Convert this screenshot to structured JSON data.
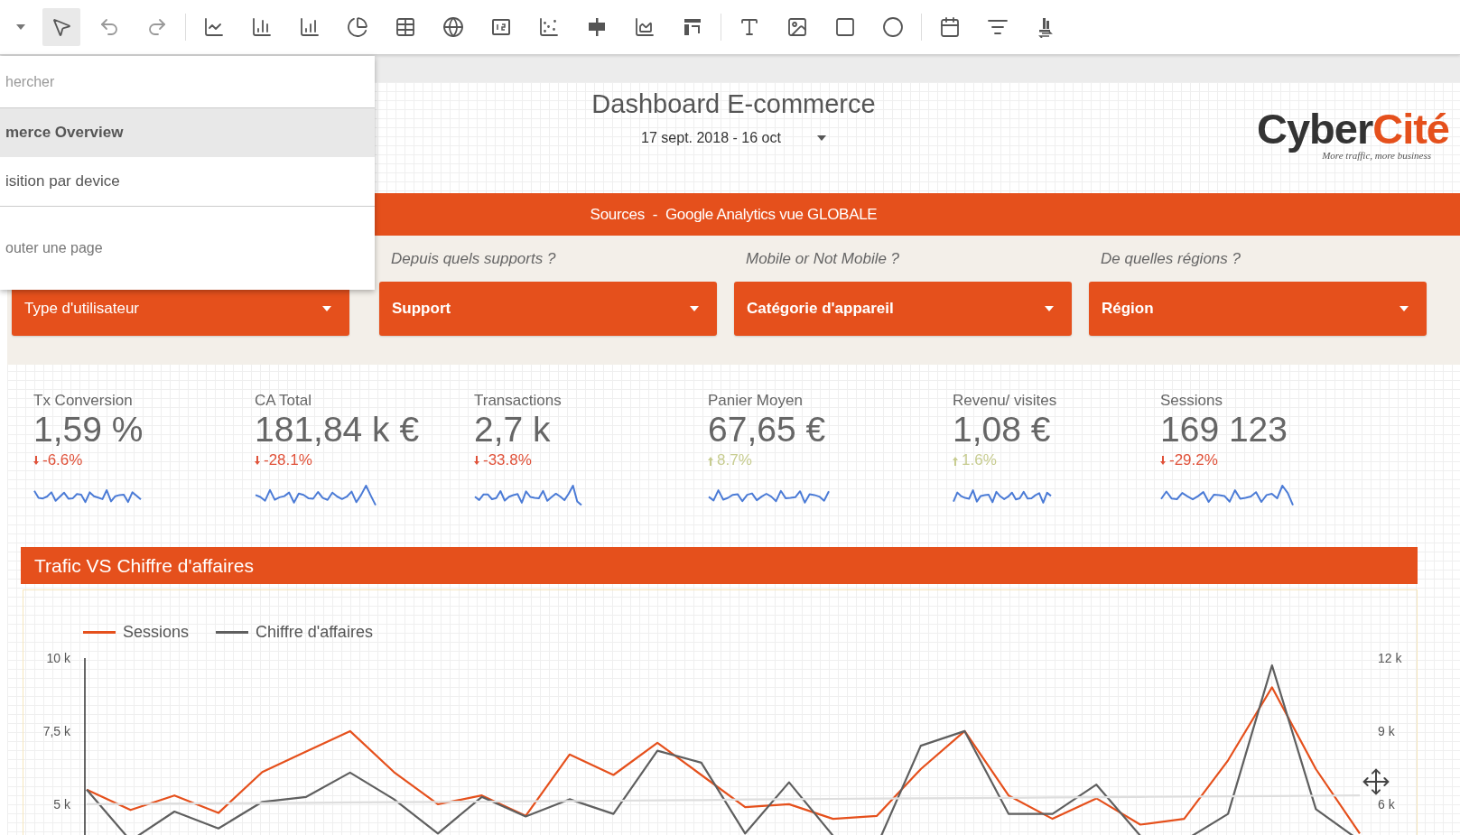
{
  "toolbar": {
    "groups": [
      [
        {
          "kind": "caret",
          "selected": false
        },
        {
          "kind": "pointer",
          "selected": true
        },
        {
          "kind": "undo",
          "selected": false
        },
        {
          "kind": "redo",
          "selected": false
        }
      ],
      [
        {
          "kind": "line",
          "selected": false
        },
        {
          "kind": "bar",
          "selected": false
        },
        {
          "kind": "combo",
          "selected": false
        },
        {
          "kind": "pie",
          "selected": false
        },
        {
          "kind": "table",
          "selected": false
        },
        {
          "kind": "geo",
          "selected": false
        },
        {
          "kind": "scorecard",
          "selected": false
        },
        {
          "kind": "scatter",
          "selected": false
        },
        {
          "kind": "bullet",
          "selected": false
        },
        {
          "kind": "area",
          "selected": false
        },
        {
          "kind": "pivot",
          "selected": false
        }
      ],
      [
        {
          "kind": "text",
          "selected": false
        },
        {
          "kind": "image",
          "selected": false
        },
        {
          "kind": "rectangle",
          "selected": false
        },
        {
          "kind": "circle",
          "selected": false
        }
      ],
      [
        {
          "kind": "date",
          "selected": false
        },
        {
          "kind": "filter",
          "selected": false
        },
        {
          "kind": "data-control",
          "selected": false
        }
      ]
    ]
  },
  "page_menu": {
    "search_placeholder": "hercher",
    "pages": [
      {
        "label": "merce Overview",
        "selected": true
      },
      {
        "label": "isition par device",
        "selected": false
      }
    ],
    "add_page": "outer une page"
  },
  "header": {
    "title": "Dashboard E-commerce",
    "date_range": "17 sept. 2018 - 16 oct"
  },
  "logo": {
    "brand_dark": "Cyber",
    "brand_accent": "Cité",
    "tagline": "More traffic, more business"
  },
  "banner": "Sources  -  Google Analytics vue GLOBALE",
  "filters": [
    {
      "control": "Type d'utilisateur",
      "emphasized": false
    },
    {
      "question": "Depuis quels supports ?",
      "control": "Support",
      "emphasized": true
    },
    {
      "question": "Mobile or Not Mobile ?",
      "control": "Catégorie d'appareil",
      "emphasized": true
    },
    {
      "question": "De quelles régions ?",
      "control": "Région",
      "emphasized": true
    }
  ],
  "kpis": [
    {
      "label": "Tx Conversion",
      "value": "1,59 %",
      "change": "-6.6%",
      "trend_up": false
    },
    {
      "label": "CA Total",
      "value": "181,84 k €",
      "change": "-28.1%",
      "trend_up": false
    },
    {
      "label": "Transactions",
      "value": "2,7 k",
      "change": "-33.8%",
      "trend_up": false
    },
    {
      "label": "Panier Moyen",
      "value": "67,65 €",
      "change": "8.7%",
      "trend_up": true
    },
    {
      "label": "Revenu/ visites",
      "value": "1,08 €",
      "change": "1.6%",
      "trend_up": true
    },
    {
      "label": "Sessions",
      "value": "169 123",
      "change": "-29.2%",
      "trend_up": false
    }
  ],
  "chart": {
    "title": "Trafic VS Chiffre d'affaires",
    "chart_data": {
      "type": "line",
      "series": [
        {
          "name": "Sessions",
          "color": "#e5501c",
          "values": [
            5.5,
            4.8,
            5.3,
            4.7,
            6.1,
            6.8,
            7.5,
            6.1,
            5.0,
            5.3,
            4.6,
            6.7,
            6.0,
            7.1,
            6.0,
            4.9,
            5.0,
            4.5,
            4.6,
            6.2,
            7.5,
            5.3,
            4.5,
            5.2,
            4.3,
            4.5,
            6.5,
            9.0,
            6.2,
            4.0
          ]
        },
        {
          "name": "Chiffre d'affaires",
          "color": "#5f5f5f",
          "values": [
            5.5,
            3.75,
            4.75,
            4.17,
            5.08,
            5.25,
            6.08,
            5.17,
            4.0,
            5.25,
            4.58,
            5.17,
            4.67,
            6.83,
            6.42,
            4.0,
            5.75,
            3.92,
            3.58,
            7.0,
            7.5,
            4.67,
            4.67,
            5.67,
            3.92,
            3.75,
            4.67,
            9.75,
            4.83,
            3.75
          ]
        },
        {
          "color": "#dedede",
          "values": [
            5.0,
            5.01,
            5.02,
            5.03,
            5.04,
            5.05,
            5.06,
            5.07,
            5.08,
            5.09,
            5.1,
            5.11,
            5.12,
            5.13,
            5.14,
            5.16,
            5.17,
            5.18,
            5.19,
            5.2,
            5.21,
            5.22,
            5.23,
            5.24,
            5.25,
            5.26,
            5.27,
            5.28,
            5.29,
            5.3
          ]
        }
      ],
      "ylim": [
        2,
        10
      ],
      "yticks": [
        {
          "value": 5,
          "label": "5 k"
        },
        {
          "value": 7.5,
          "label": "7,5 k"
        },
        {
          "value": 10,
          "label": "10 k"
        }
      ]
    },
    "right_axis_labels": [
      "12 k",
      "9 k",
      "6 k"
    ]
  }
}
